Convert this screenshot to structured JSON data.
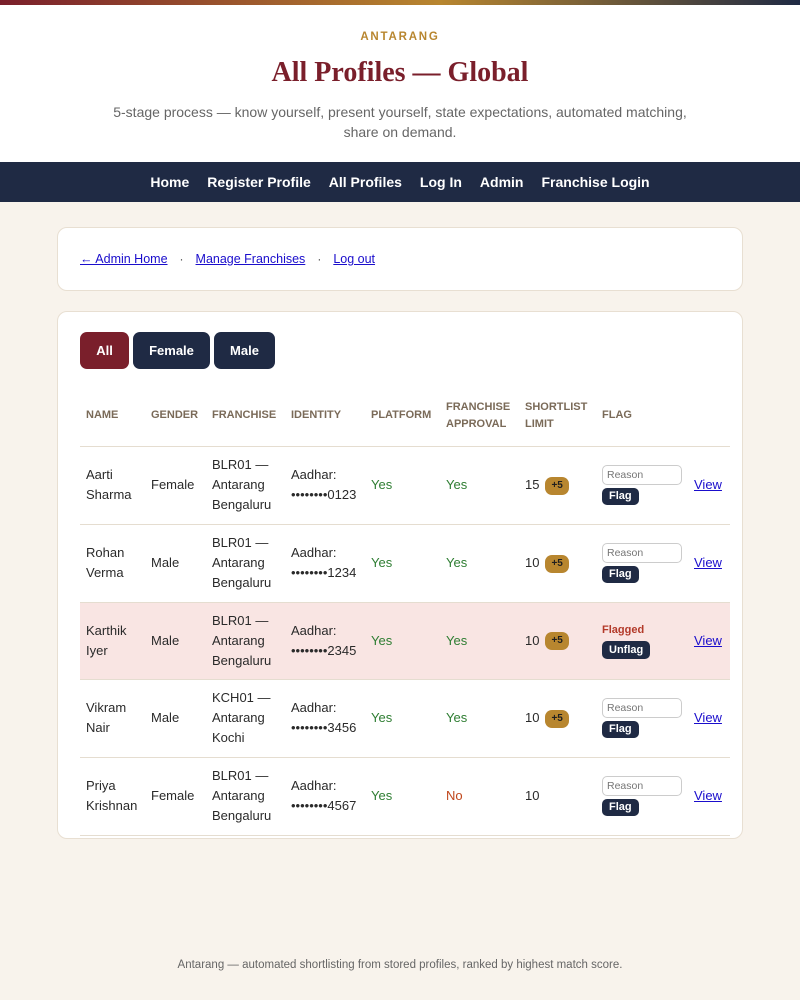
{
  "header": {
    "brand": "ANTARANG",
    "title": "All Profiles — Global",
    "subtitle": "5-stage process — know yourself, present yourself, state expectations, automated matching, share on demand."
  },
  "nav": [
    "Home",
    "Register Profile",
    "All Profiles",
    "Log In",
    "Admin",
    "Franchise Login"
  ],
  "admin_links": {
    "admin_home": "← Admin Home",
    "manage_franchises": "Manage Franchises",
    "logout": "Log out",
    "separator": "·"
  },
  "filters": [
    "All",
    "Female",
    "Male"
  ],
  "active_filter": "All",
  "table": {
    "headers": {
      "name": "NAME",
      "gender": "GENDER",
      "franchise": "FRANCHISE",
      "identity": "IDENTITY",
      "platform": "PLATFORM",
      "franchise_approval": "FRANCHISE APPROVAL",
      "shortlist_limit": "SHORTLIST LIMIT",
      "flag": "FLAG"
    },
    "flag_placeholder": "Reason",
    "flag_button": "Flag",
    "unflag_button": "Unflag",
    "flagged_label": "Flagged",
    "plus_label": "+5",
    "view_label": "View",
    "rows": [
      {
        "name": "Aarti Sharma",
        "gender": "Female",
        "franchise": "BLR01 — Antarang Bengaluru",
        "identity_type": "Aadhar:",
        "identity_mask": "••••••••0123",
        "platform": "Yes",
        "approval": "Yes",
        "limit": "15",
        "plus": true,
        "flagged": false
      },
      {
        "name": "Rohan Verma",
        "gender": "Male",
        "franchise": "BLR01 — Antarang Bengaluru",
        "identity_type": "Aadhar:",
        "identity_mask": "••••••••1234",
        "platform": "Yes",
        "approval": "Yes",
        "limit": "10",
        "plus": true,
        "flagged": false
      },
      {
        "name": "Karthik Iyer",
        "gender": "Male",
        "franchise": "BLR01 — Antarang Bengaluru",
        "identity_type": "Aadhar:",
        "identity_mask": "••••••••2345",
        "platform": "Yes",
        "approval": "Yes",
        "limit": "10",
        "plus": true,
        "flagged": true
      },
      {
        "name": "Vikram Nair",
        "gender": "Male",
        "franchise": "KCH01 — Antarang Kochi",
        "identity_type": "Aadhar:",
        "identity_mask": "••••••••3456",
        "platform": "Yes",
        "approval": "Yes",
        "limit": "10",
        "plus": true,
        "flagged": false
      },
      {
        "name": "Priya Krishnan",
        "gender": "Female",
        "franchise": "BLR01 — Antarang Bengaluru",
        "identity_type": "Aadhar:",
        "identity_mask": "••••••••4567",
        "platform": "Yes",
        "approval": "No",
        "limit": "10",
        "plus": false,
        "flagged": false
      }
    ]
  },
  "footer": "Antarang — automated shortlisting from stored profiles, ranked by highest match score.",
  "colors": {
    "maroon": "#7a1f2b",
    "navy": "#1f2a44",
    "gold": "#b8862f",
    "green": "#2e7d32",
    "no": "#c0471c",
    "flagged_row": "#f9e5e3"
  }
}
